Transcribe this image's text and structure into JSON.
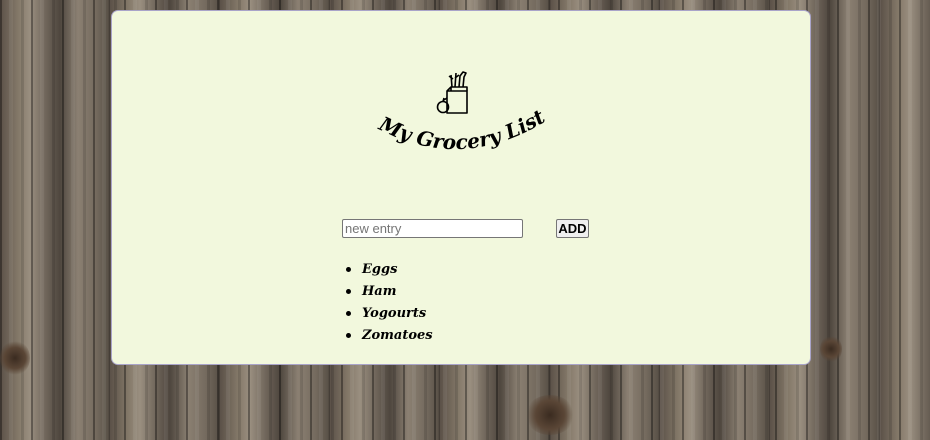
{
  "app": {
    "title": "My Grocery List",
    "logo_icon": "grocery-bag-icon"
  },
  "form": {
    "input_placeholder": "new entry",
    "input_value": "",
    "add_label": "ADD"
  },
  "list": {
    "items": [
      {
        "label": "Eggs"
      },
      {
        "label": "Ham"
      },
      {
        "label": "Yogourts"
      },
      {
        "label": "Zomatoes"
      }
    ]
  },
  "colors": {
    "panel_background": "#f2f8dd",
    "panel_border": "#a9a4c9",
    "text": "#000000"
  }
}
